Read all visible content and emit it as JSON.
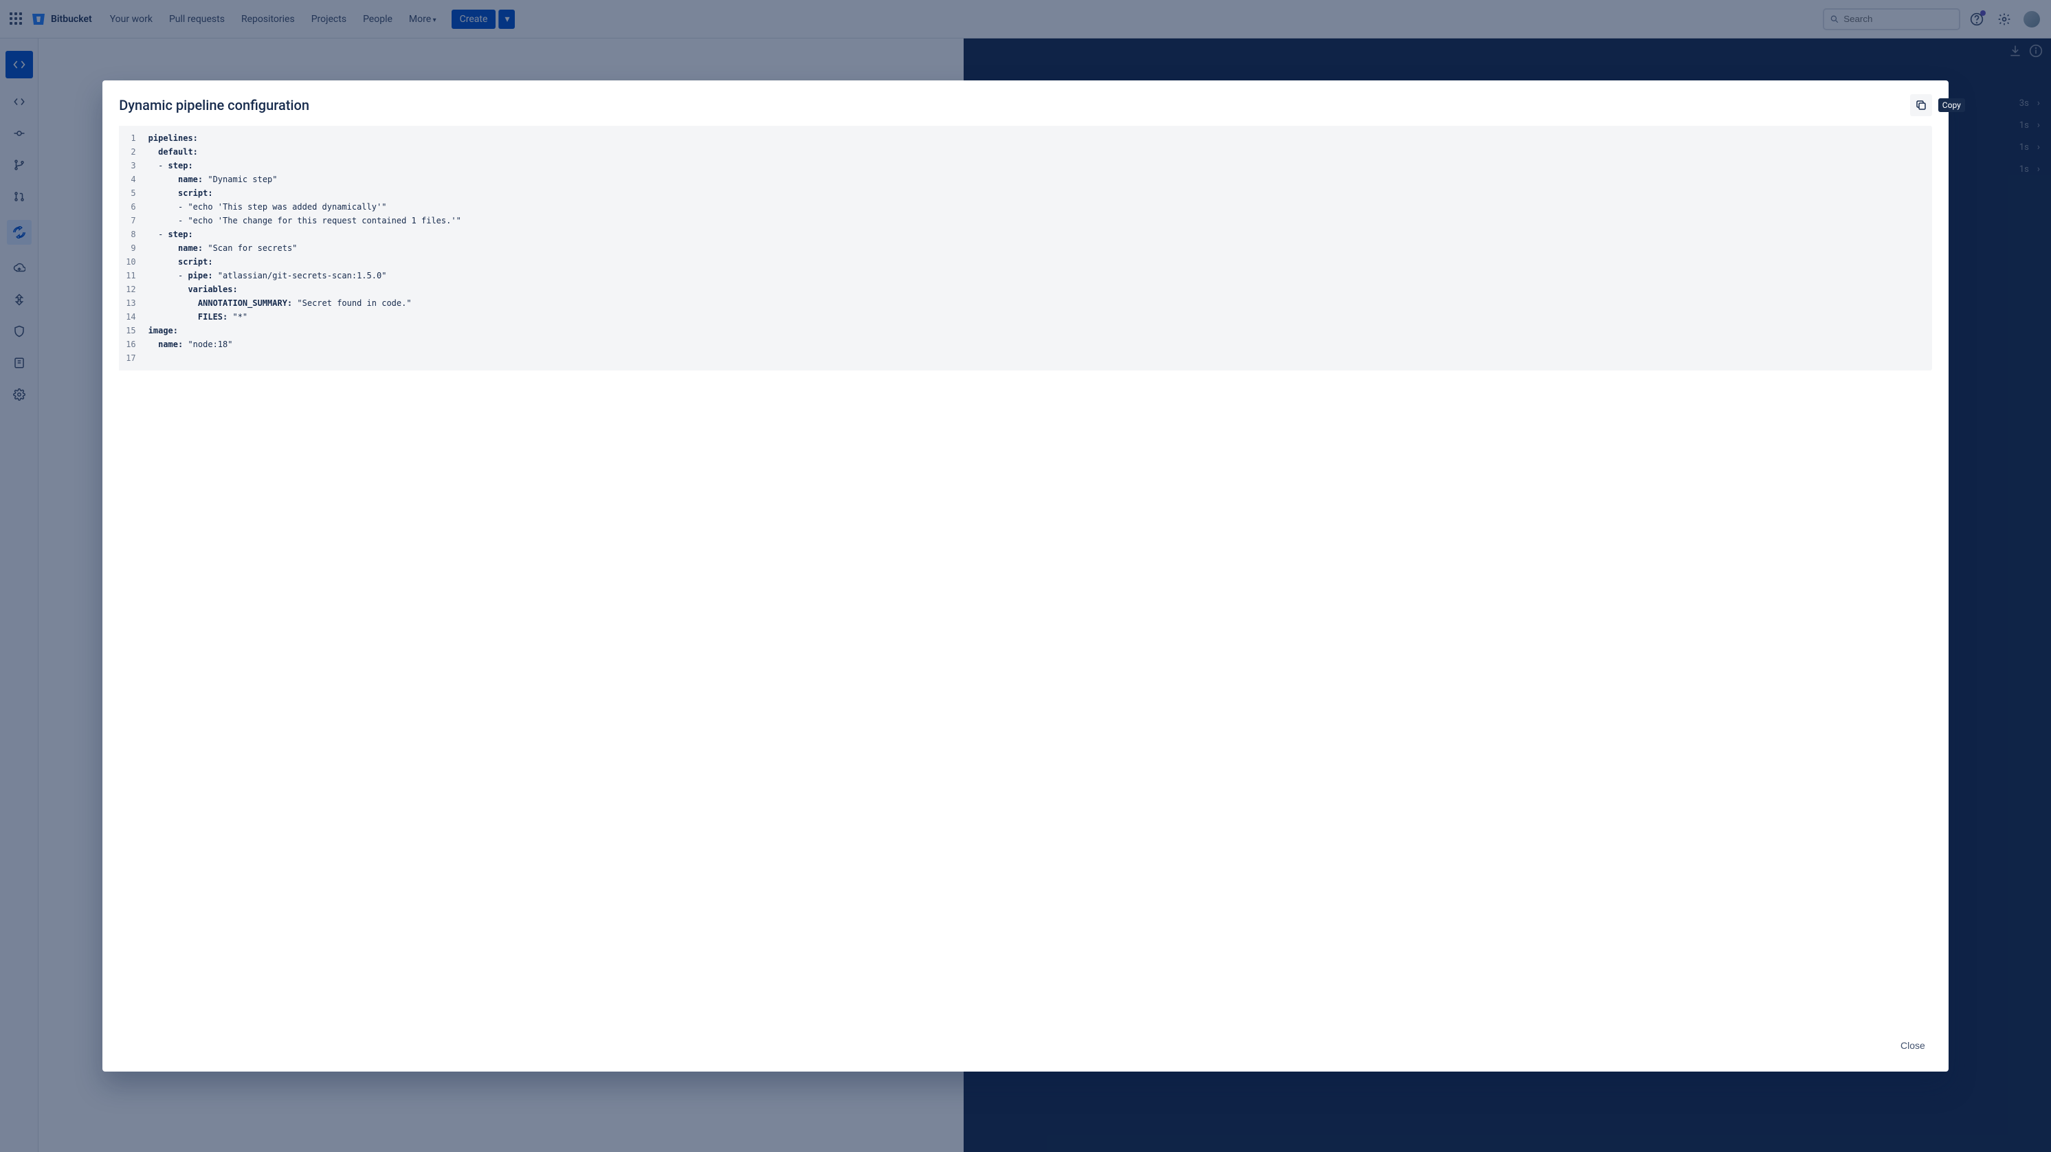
{
  "nav": {
    "product": "Bitbucket",
    "items": [
      "Your work",
      "Pull requests",
      "Repositories",
      "Projects",
      "People",
      "More"
    ],
    "create": "Create",
    "search_placeholder": "Search"
  },
  "modal": {
    "title": "Dynamic pipeline configuration",
    "copy_tooltip": "Copy",
    "close": "Close",
    "code_lines": [
      [
        [
          "k",
          "pipelines:"
        ]
      ],
      [
        [
          "p",
          "  "
        ],
        [
          "k",
          "default:"
        ]
      ],
      [
        [
          "p",
          "  - "
        ],
        [
          "k",
          "step:"
        ]
      ],
      [
        [
          "p",
          "      "
        ],
        [
          "k",
          "name:"
        ],
        [
          "t",
          " \"Dynamic step\""
        ]
      ],
      [
        [
          "p",
          "      "
        ],
        [
          "k",
          "script:"
        ]
      ],
      [
        [
          "p",
          "      "
        ],
        [
          "t",
          "- \"echo 'This step was added dynamically'\""
        ]
      ],
      [
        [
          "p",
          "      "
        ],
        [
          "t",
          "- \"echo 'The change for this request contained 1 files.'\""
        ]
      ],
      [
        [
          "p",
          "  - "
        ],
        [
          "k",
          "step:"
        ]
      ],
      [
        [
          "p",
          "      "
        ],
        [
          "k",
          "name:"
        ],
        [
          "t",
          " \"Scan for secrets\""
        ]
      ],
      [
        [
          "p",
          "      "
        ],
        [
          "k",
          "script:"
        ]
      ],
      [
        [
          "p",
          "      - "
        ],
        [
          "k",
          "pipe:"
        ],
        [
          "t",
          " \"atlassian/git-secrets-scan:1.5.0\""
        ]
      ],
      [
        [
          "p",
          "        "
        ],
        [
          "k",
          "variables:"
        ]
      ],
      [
        [
          "p",
          "          "
        ],
        [
          "k",
          "ANNOTATION_SUMMARY:"
        ],
        [
          "t",
          " \"Secret found in code.\""
        ]
      ],
      [
        [
          "p",
          "          "
        ],
        [
          "k",
          "FILES:"
        ],
        [
          "t",
          " \"*\""
        ]
      ],
      [
        [
          "k",
          "image:"
        ]
      ],
      [
        [
          "p",
          "  "
        ],
        [
          "k",
          "name:"
        ],
        [
          "t",
          " \"node:18\""
        ]
      ],
      [
        [
          "t",
          ""
        ]
      ]
    ]
  },
  "right_times": [
    "3s",
    "1s",
    "1s",
    "1s"
  ]
}
